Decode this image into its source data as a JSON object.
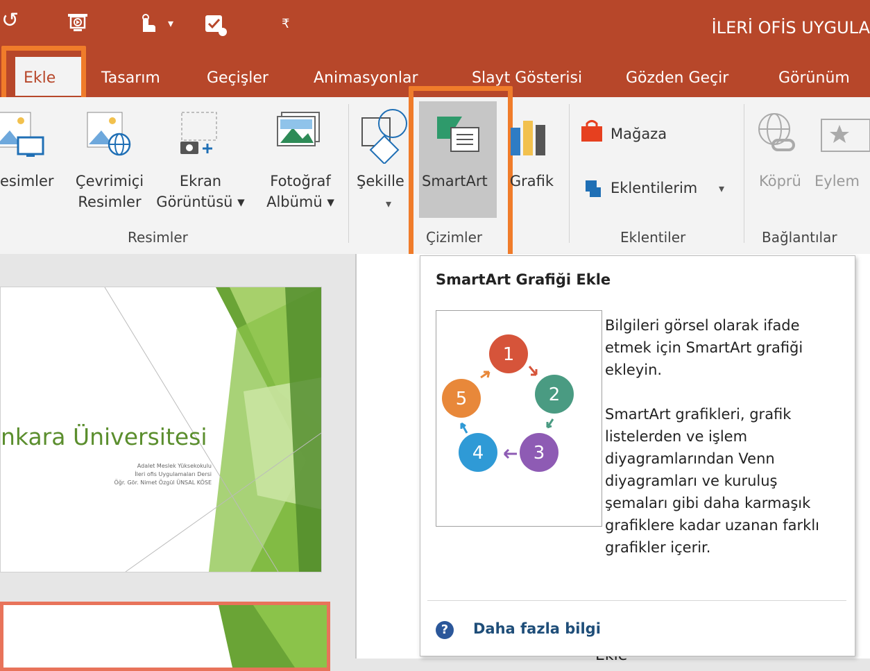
{
  "titlebar": {
    "document_title": "İLERİ OFİS UYGULA",
    "quick_access": [
      "undo-icon",
      "presentation-icon",
      "touch-mode-icon",
      "proofing-icon",
      "customize-icon"
    ]
  },
  "tabs": [
    "Ekle",
    "Tasarım",
    "Geçişler",
    "Animasyonlar",
    "Slayt Gösterisi",
    "Gözden Geçir",
    "Görünüm"
  ],
  "ribbon": {
    "resimler": {
      "items": [
        "esimler",
        "Çevrimiçi\nResimler",
        "Ekran\nGörüntüsü ▾",
        "Fotoğraf\nAlbümü ▾"
      ],
      "group_label": "Resimler"
    },
    "cizimler": {
      "sekiller": "Şekille",
      "smartart": "SmartArt",
      "grafik": "Grafik",
      "group_label": "Çizimler"
    },
    "eklentiler": {
      "magaza": "Mağaza",
      "eklentilerim": "Eklentilerim",
      "group_label": "Eklentiler"
    },
    "baglantilar": {
      "kopru": "Köprü",
      "eylem": "Eylem",
      "group_label": "Bağlantılar"
    }
  },
  "slide": {
    "title": "nkara Üniversitesi",
    "lines": [
      "Adalet Meslek Yüksekokulu",
      "İleri ofis Uygulamaları Dersi",
      "Öğr. Gör. Nimet Özgül ÜNSAL KÖSE"
    ]
  },
  "tooltip": {
    "title": "SmartArt Grafiği Ekle",
    "paragraphs": [
      "Bilgileri görsel olarak ifade etmek için SmartArt grafiği ekleyin.",
      "SmartArt grafikleri, grafik listelerden ve işlem diyagramlarından Venn diyagramları ve kuruluş şemaları gibi daha karmaşık grafiklere kadar uzanan farklı grafikler içerir."
    ],
    "cycle_numbers": [
      "1",
      "2",
      "3",
      "4",
      "5"
    ],
    "more_info": "Daha fazla bilgi"
  },
  "bottom_peek": "Ekle",
  "colors": {
    "accent": "#b7472a",
    "highlight": "#f07c2a",
    "link": "#1f4e79"
  }
}
